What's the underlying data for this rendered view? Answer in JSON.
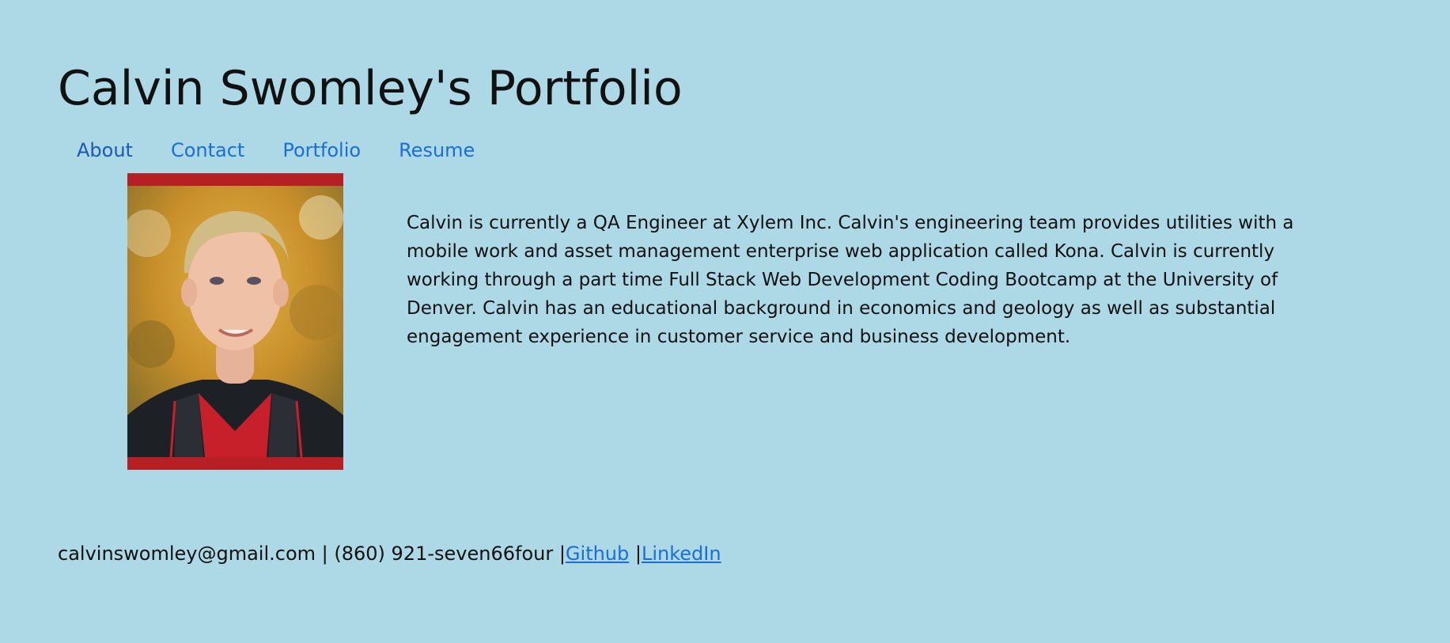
{
  "header": {
    "title": "Calvin Swomley's Portfolio"
  },
  "nav": {
    "items": [
      {
        "label": "About"
      },
      {
        "label": "Contact"
      },
      {
        "label": "Portfolio"
      },
      {
        "label": "Resume"
      }
    ]
  },
  "about": {
    "photo_icon": "portrait-photo",
    "bio": "Calvin is currently a QA Engineer at Xylem Inc. Calvin's engineering team provides utilities with a mobile work and asset management enterprise web application called Kona. Calvin is currently working through a part time Full Stack Web Development Coding Bootcamp at the University of Denver. Calvin has an educational background in economics and geology as well as substantial engagement experience in customer service and business development."
  },
  "footer": {
    "contact_text": "calvinswomley@gmail.com | (860) 921-seven66four |",
    "separator": " |",
    "github_label": "Github",
    "linkedin_label": "LinkedIn"
  },
  "colors": {
    "background": "#add8e6",
    "link": "#1a6ed8",
    "photo_frame": "#b61f24"
  }
}
